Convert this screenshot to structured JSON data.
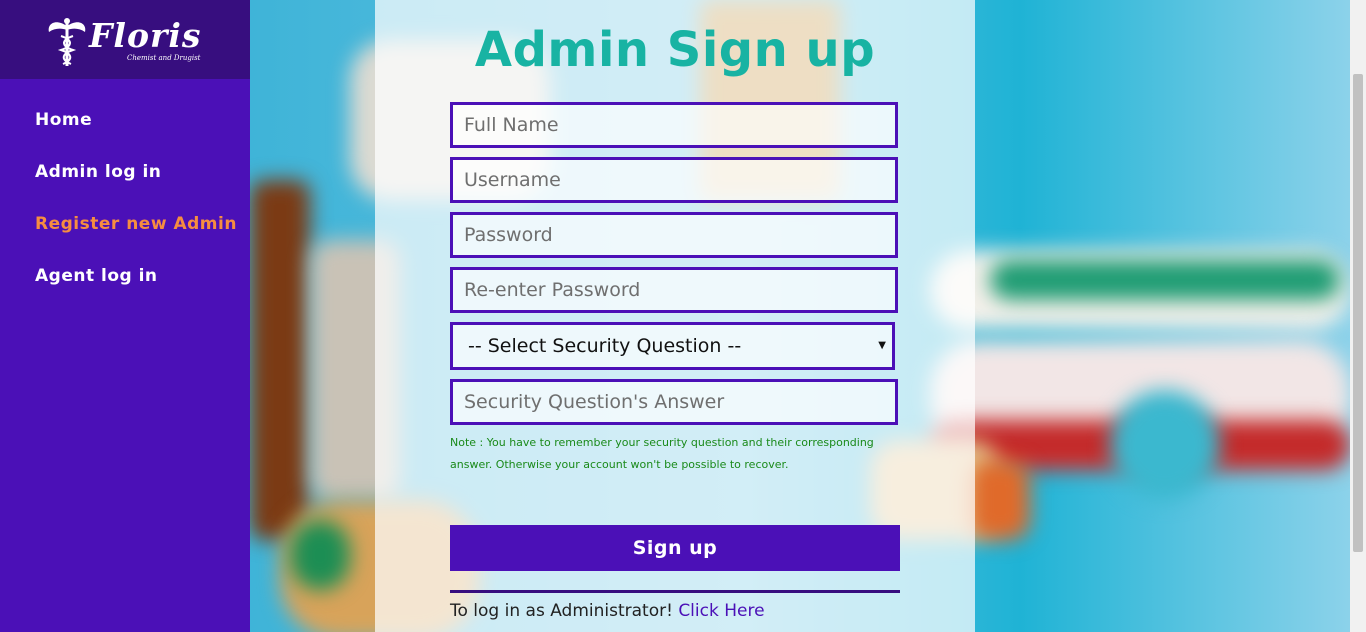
{
  "brand": {
    "name": "Floris",
    "tagline": "Chemist and Drugist"
  },
  "sidebar": {
    "items": [
      {
        "label": "Home",
        "active": false
      },
      {
        "label": "Admin log in",
        "active": false
      },
      {
        "label": "Register new Admin",
        "active": true
      },
      {
        "label": "Agent log in",
        "active": false
      }
    ]
  },
  "form": {
    "title": "Admin Sign up",
    "fields": {
      "full_name": {
        "placeholder": "Full Name",
        "value": ""
      },
      "username": {
        "placeholder": "Username",
        "value": ""
      },
      "password": {
        "placeholder": "Password",
        "value": ""
      },
      "reenter_password": {
        "placeholder": "Re-enter Password",
        "value": ""
      },
      "security_answer": {
        "placeholder": "Security Question's Answer",
        "value": ""
      }
    },
    "security_question": {
      "selected": "-- Select Security Question --"
    },
    "note": "Note : You have to remember your security question and their corresponding answer. Otherwise your account won't be possible to recover.",
    "submit_label": "Sign up",
    "login_prompt": "To log in as Administrator!",
    "login_link": "Click Here"
  },
  "colors": {
    "sidebar": "#4b10b7",
    "logo_bar": "#370e7f",
    "active_nav": "#f68d40",
    "title": "#18b3a3",
    "note": "#1a8a1a"
  }
}
